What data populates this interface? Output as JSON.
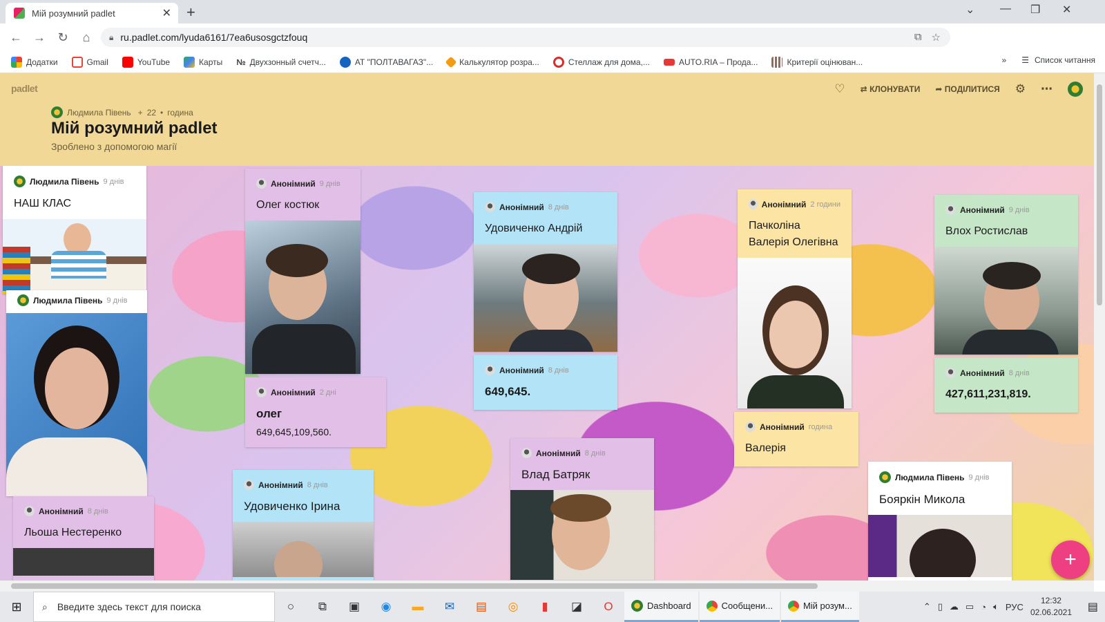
{
  "browser": {
    "tab_title": "Мій розумний padlet",
    "url": "ru.padlet.com/lyuda6161/7ea6usosgctzfouq",
    "bookmarks": [
      "Додатки",
      "Gmail",
      "YouTube",
      "Карты",
      "Двухзонный счетч...",
      "АТ \"ПОЛТАВАГАЗ\"...",
      "Калькулятор розра...",
      "Стеллаж для дома,...",
      "AUTO.RIA – Прода...",
      "Критерії оцінюван..."
    ],
    "reading_list": "Список читання"
  },
  "header": {
    "logo": "padlet",
    "clone_label": "КЛОНУВАТИ",
    "share_label": "ПОДІЛИТИСЯ",
    "author": "Людмила Півень",
    "plus": "+",
    "likes": "22",
    "time": "година",
    "title": "Мій розумний padlet",
    "subtitle": "Зроблено з допомогою магії"
  },
  "posts": [
    {
      "author": "Людмила Півень",
      "ago": "9 днів",
      "title": "НАШ КЛАС"
    },
    {
      "author": "Людмила Півень",
      "ago": "9 днів"
    },
    {
      "author": "Анонімний",
      "ago": "8 днів",
      "title": "Льоша Нестеренко"
    },
    {
      "author": "Анонімний",
      "ago": "9 днів",
      "title": "Олег костюк"
    },
    {
      "author": "Анонімний",
      "ago": "2 дні",
      "title": "олег",
      "body": "649,645,109,560."
    },
    {
      "author": "Анонімний",
      "ago": "8 днів",
      "title": "Удовиченко Ірина"
    },
    {
      "author": "Анонімний",
      "ago": "8 днів",
      "title": "Удовиченко Андрій"
    },
    {
      "author": "Анонімний",
      "ago": "8 днів",
      "title": "649,645."
    },
    {
      "author": "Анонімний",
      "ago": "8 днів",
      "title": "Влад Батряк"
    },
    {
      "author": "Анонімний",
      "ago": "2 години",
      "title": "Пачколіна Валерія Олегівна"
    },
    {
      "author": "Анонімний",
      "ago": "година",
      "title": "Валерія"
    },
    {
      "author": "Анонімний",
      "ago": "9 днів",
      "title": "Влох Ростислав"
    },
    {
      "author": "Анонімний",
      "ago": "8 днів",
      "title": "427,611,231,819."
    },
    {
      "author": "Людмила Півень",
      "ago": "9 днів",
      "title": "Бояркін Микола"
    }
  ],
  "fab_label": "+",
  "taskbar": {
    "search_placeholder": "Введите здесь текст для поиска",
    "apps": [
      "Dashboard",
      "Сообщени...",
      "Мій розум..."
    ],
    "lang": "РУС",
    "time": "12:32",
    "date": "02.06.2021"
  },
  "colors": {
    "header_bg": "#f1d896",
    "fab": "#ee3f82",
    "lilac": "#e2bfe6",
    "blue": "#b3e3f7",
    "yellow": "#fbe4a4",
    "green": "#c5e6c7"
  }
}
